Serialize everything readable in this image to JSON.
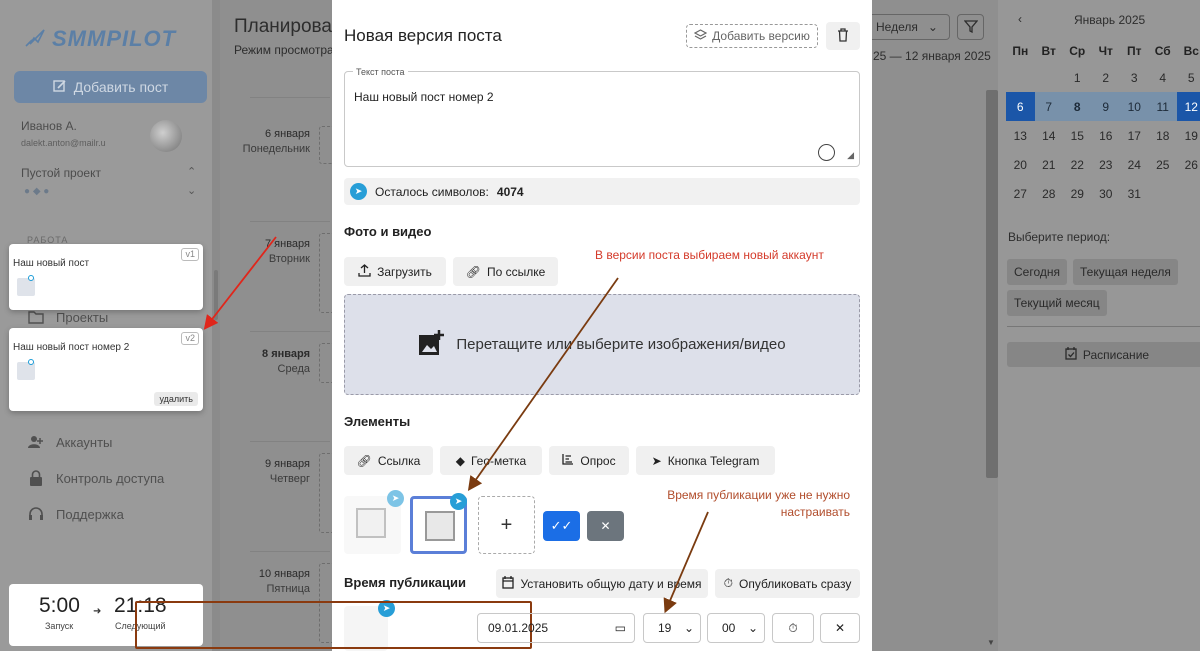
{
  "sidebar": {
    "logo_text": "SMMPILOT",
    "add_post_label": "Добавить пост",
    "user_name": "Иванов А.",
    "user_email": "dalekt.anton@mailr.u",
    "project_name": "Пустой проект",
    "section_label": "РАБОТА",
    "items": [
      {
        "label": "Проекты",
        "icon": "folder-icon"
      },
      {
        "label": "Аккаунты",
        "icon": "person-add-icon"
      },
      {
        "label": "Контроль доступа",
        "icon": "lock-icon"
      },
      {
        "label": "Поддержка",
        "icon": "headset-icon"
      }
    ],
    "versions": [
      {
        "title": "Наш новый пост",
        "tag": "v1"
      },
      {
        "title": "Наш новый пост номер 2",
        "tag": "v2",
        "delete_label": "удалить"
      }
    ],
    "launch_time": "5:00",
    "launch_label": "Запуск",
    "next_time": "21:18",
    "next_label": "Следующий"
  },
  "main": {
    "title": "Планирова",
    "subtitle": "Режим просмотра",
    "week_select": "Неделя",
    "date_range": "25 — 12 января 2025",
    "days": [
      {
        "date": "6 января",
        "weekday": "Понедельник",
        "bold": false
      },
      {
        "date": "7 января",
        "weekday": "Вторник",
        "bold": false
      },
      {
        "date": "8 января",
        "weekday": "Среда",
        "bold": true
      },
      {
        "date": "9 января",
        "weekday": "Четверг",
        "bold": false
      },
      {
        "date": "10 января",
        "weekday": "Пятница",
        "bold": false
      }
    ]
  },
  "calendar": {
    "month": "Январь 2025",
    "weekdays": [
      "Пн",
      "Вт",
      "Ср",
      "Чт",
      "Пт",
      "Сб",
      "Вс"
    ],
    "rows": [
      [
        "",
        "",
        "1",
        "2",
        "3",
        "4",
        "5"
      ],
      [
        "6",
        "7",
        "8",
        "9",
        "10",
        "11",
        "12"
      ],
      [
        "13",
        "14",
        "15",
        "16",
        "17",
        "18",
        "19"
      ],
      [
        "20",
        "21",
        "22",
        "23",
        "24",
        "25",
        "26"
      ],
      [
        "27",
        "28",
        "29",
        "30",
        "31",
        "",
        ""
      ]
    ],
    "period_label": "Выберите период:",
    "period_today": "Сегодня",
    "period_week": "Текущая неделя",
    "period_month": "Текущий месяц",
    "schedule_label": "Расписание"
  },
  "modal": {
    "title": "Новая версия поста",
    "add_version_label": "Добавить версию",
    "post_label": "Текст поста",
    "post_text": "Наш новый пост номер 2",
    "chars_label": "Осталось символов:",
    "chars_value": "4074",
    "media_heading": "Фото и видео",
    "upload_label": "Загрузить",
    "by_link_label": "По ссылке",
    "dropzone_text": "Перетащите или выберите изображения/видео",
    "elements_heading": "Элементы",
    "el_link": "Ссылка",
    "el_geo": "Гео-метка",
    "el_poll": "Опрос",
    "el_tg_button": "Кнопка Telegram",
    "pub_heading": "Время публикации",
    "set_common_label": "Установить общую дату и время",
    "publish_now_label": "Опубликовать сразу",
    "date_value": "09.01.2025",
    "hour_value": "19",
    "minute_value": "00"
  },
  "annotations": {
    "note1": "В версии поста выбираем новый аккаунт",
    "note2_line1": "Время публикации уже не нужно",
    "note2_line2": "настраивать"
  },
  "colors": {
    "accent": "#1b6ee6",
    "telegram": "#279ed7",
    "annotation": "#d43a2a",
    "highlight_box": "#8a3a0f"
  }
}
